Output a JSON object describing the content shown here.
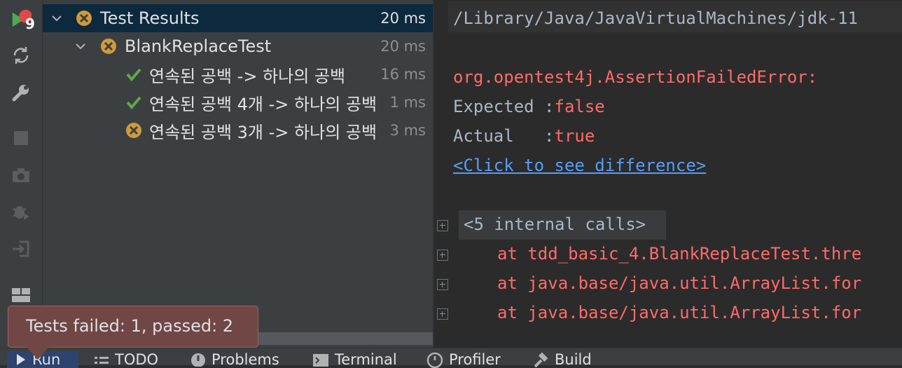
{
  "toolbar": {
    "icons": [
      "rerun-icon",
      "rerun-failed-icon",
      "settings-icon",
      "stop-icon",
      "snapshot-icon",
      "debug-icon",
      "import-icon",
      "layout-icon"
    ],
    "badge": "9"
  },
  "tree": {
    "rows": [
      {
        "label": "Test Results",
        "time": "20 ms",
        "status": "fail"
      },
      {
        "label": "BlankReplaceTest",
        "time": "20 ms",
        "status": "fail"
      },
      {
        "label": "연속된 공백 -> 하나의 공백",
        "time": "16 ms",
        "status": "pass"
      },
      {
        "label": "연속된 공백 4개 -> 하나의 공백",
        "time": "1 ms",
        "status": "pass"
      },
      {
        "label": "연속된 공백 3개 -> 하나의 공백",
        "time": "3 ms",
        "status": "fail"
      }
    ]
  },
  "console": {
    "path": "/Library/Java/JavaVirtualMachines/jdk-11",
    "error": "org.opentest4j.AssertionFailedError:",
    "expected_label": "Expected :",
    "expected_value": "false",
    "actual_label": "Actual   :",
    "actual_value": "true",
    "diff_link": "<Click to see difference>",
    "internal_calls": "<5 internal calls>",
    "stack": [
      "at tdd_basic_4.BlankReplaceTest.thre",
      "at java.base/java.util.ArrayList.for",
      "at java.base/java.util.ArrayList.for"
    ]
  },
  "tooltip": {
    "text": "Tests failed: 1, passed: 2"
  },
  "bottom_tabs": [
    "Run",
    "TODO",
    "Problems",
    "Terminal",
    "Profiler",
    "Build"
  ],
  "colors": {
    "pass": "#5fa84a",
    "fail": "#cf9b3a",
    "error": "#ff6b68",
    "link": "#589df6"
  }
}
